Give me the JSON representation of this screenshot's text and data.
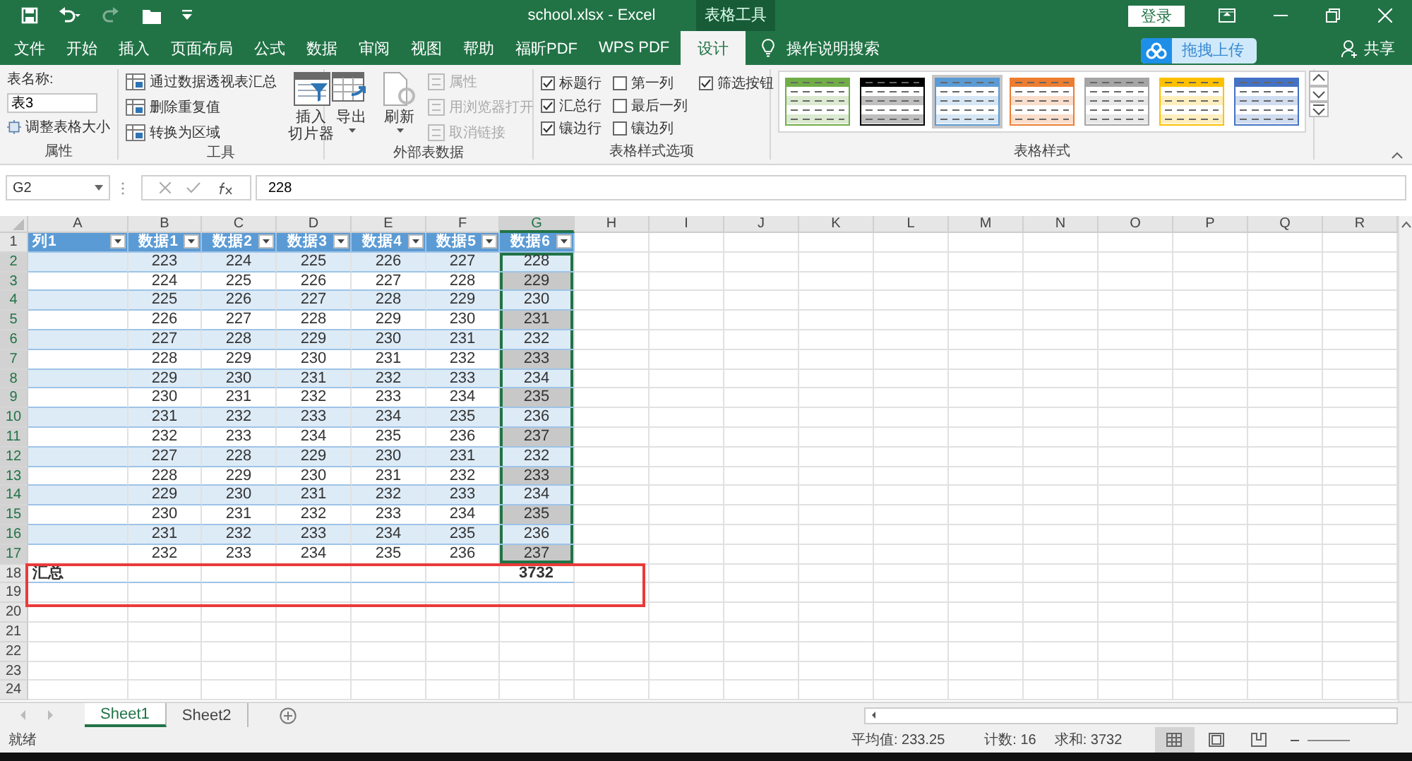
{
  "title_bar": {
    "title": "school.xlsx  -  Excel",
    "context_label": "表格工具",
    "login": "登录"
  },
  "ribbon_tabs": [
    {
      "label": "文件",
      "selected": false
    },
    {
      "label": "开始",
      "selected": false
    },
    {
      "label": "插入",
      "selected": false
    },
    {
      "label": "页面布局",
      "selected": false
    },
    {
      "label": "公式",
      "selected": false
    },
    {
      "label": "数据",
      "selected": false
    },
    {
      "label": "审阅",
      "selected": false
    },
    {
      "label": "视图",
      "selected": false
    },
    {
      "label": "帮助",
      "selected": false
    },
    {
      "label": "福昕PDF",
      "selected": false
    },
    {
      "label": "WPS PDF",
      "selected": false
    },
    {
      "label": "设计",
      "selected": true
    }
  ],
  "tell_me": "操作说明搜索",
  "upload": "拖拽上传",
  "share": "共享",
  "ribbon": {
    "properties": {
      "title": "属性",
      "name_label": "表名称:",
      "table_name": "表3",
      "resize": "调整表格大小"
    },
    "tools": {
      "title": "工具",
      "items": [
        "通过数据透视表汇总",
        "删除重复值",
        "转换为区域"
      ],
      "slicer": [
        "插入",
        "切片器"
      ]
    },
    "external": {
      "title": "外部表数据",
      "export": "导出",
      "refresh": "刷新",
      "items": [
        {
          "label": "属性",
          "disabled": true
        },
        {
          "label": "用浏览器打开",
          "disabled": true
        },
        {
          "label": "取消链接",
          "disabled": true
        }
      ]
    },
    "style_options": {
      "title": "表格样式选项",
      "options": [
        {
          "label": "标题行",
          "checked": true
        },
        {
          "label": "汇总行",
          "checked": true
        },
        {
          "label": "镶边行",
          "checked": true
        },
        {
          "label": "第一列",
          "checked": false
        },
        {
          "label": "最后一列",
          "checked": false
        },
        {
          "label": "镶边列",
          "checked": false
        },
        {
          "label": "筛选按钮",
          "checked": true
        }
      ]
    },
    "styles": {
      "title": "表格样式",
      "swatches": [
        {
          "color": "#70ad47",
          "selected": false
        },
        {
          "color": "#000000",
          "selected": false
        },
        {
          "color": "#5b9bd5",
          "selected": true
        },
        {
          "color": "#ed7d31",
          "selected": false
        },
        {
          "color": "#a5a5a5",
          "selected": false
        },
        {
          "color": "#ffc000",
          "selected": false
        },
        {
          "color": "#4472c4",
          "selected": false
        }
      ]
    }
  },
  "formula_bar": {
    "name_box": "G2",
    "formula": "228"
  },
  "sheet": {
    "columns": [
      {
        "letter": "A",
        "selected": false
      },
      {
        "letter": "B",
        "selected": false
      },
      {
        "letter": "C",
        "selected": false
      },
      {
        "letter": "D",
        "selected": false
      },
      {
        "letter": "E",
        "selected": false
      },
      {
        "letter": "F",
        "selected": false
      },
      {
        "letter": "G",
        "selected": true
      },
      {
        "letter": "H",
        "selected": false
      },
      {
        "letter": "I",
        "selected": false
      },
      {
        "letter": "J",
        "selected": false
      },
      {
        "letter": "K",
        "selected": false
      },
      {
        "letter": "L",
        "selected": false
      },
      {
        "letter": "M",
        "selected": false
      },
      {
        "letter": "N",
        "selected": false
      },
      {
        "letter": "O",
        "selected": false
      },
      {
        "letter": "P",
        "selected": false
      },
      {
        "letter": "Q",
        "selected": false
      },
      {
        "letter": "R",
        "selected": false
      }
    ],
    "row_numbers": [
      {
        "label": "1",
        "selected": false
      },
      {
        "label": "2",
        "selected": true
      },
      {
        "label": "3",
        "selected": true
      },
      {
        "label": "4",
        "selected": true
      },
      {
        "label": "5",
        "selected": true
      },
      {
        "label": "6",
        "selected": true
      },
      {
        "label": "7",
        "selected": true
      },
      {
        "label": "8",
        "selected": true
      },
      {
        "label": "9",
        "selected": true
      },
      {
        "label": "10",
        "selected": true
      },
      {
        "label": "11",
        "selected": true
      },
      {
        "label": "12",
        "selected": true
      },
      {
        "label": "13",
        "selected": true
      },
      {
        "label": "14",
        "selected": true
      },
      {
        "label": "15",
        "selected": true
      },
      {
        "label": "16",
        "selected": true
      },
      {
        "label": "17",
        "selected": true
      },
      {
        "label": "18",
        "selected": false
      },
      {
        "label": "19",
        "selected": false
      },
      {
        "label": "20",
        "selected": false
      },
      {
        "label": "21",
        "selected": false
      },
      {
        "label": "22",
        "selected": false
      },
      {
        "label": "23",
        "selected": false
      },
      {
        "label": "24",
        "selected": false
      }
    ],
    "table": {
      "header": [
        "列1",
        "数据1",
        "数据2",
        "数据3",
        "数据4",
        "数据5",
        "数据6"
      ],
      "rows": [
        {
          "values": [
            "223",
            "224",
            "225",
            "226",
            "227",
            "228"
          ]
        },
        {
          "values": [
            "224",
            "225",
            "226",
            "227",
            "228",
            "229"
          ]
        },
        {
          "values": [
            "225",
            "226",
            "227",
            "228",
            "229",
            "230"
          ]
        },
        {
          "values": [
            "226",
            "227",
            "228",
            "229",
            "230",
            "231"
          ]
        },
        {
          "values": [
            "227",
            "228",
            "229",
            "230",
            "231",
            "232"
          ]
        },
        {
          "values": [
            "228",
            "229",
            "230",
            "231",
            "232",
            "233"
          ]
        },
        {
          "values": [
            "229",
            "230",
            "231",
            "232",
            "233",
            "234"
          ]
        },
        {
          "values": [
            "230",
            "231",
            "232",
            "233",
            "234",
            "235"
          ]
        },
        {
          "values": [
            "231",
            "232",
            "233",
            "234",
            "235",
            "236"
          ]
        },
        {
          "values": [
            "232",
            "233",
            "234",
            "235",
            "236",
            "237"
          ]
        },
        {
          "values": [
            "227",
            "228",
            "229",
            "230",
            "231",
            "232"
          ]
        },
        {
          "values": [
            "228",
            "229",
            "230",
            "231",
            "232",
            "233"
          ]
        },
        {
          "values": [
            "229",
            "230",
            "231",
            "232",
            "233",
            "234"
          ]
        },
        {
          "values": [
            "230",
            "231",
            "232",
            "233",
            "234",
            "235"
          ]
        },
        {
          "values": [
            "231",
            "232",
            "233",
            "234",
            "235",
            "236"
          ]
        },
        {
          "values": [
            "232",
            "233",
            "234",
            "235",
            "236",
            "237"
          ]
        }
      ],
      "total": {
        "label": "汇总",
        "value": "3732"
      }
    }
  },
  "sheet_tabs": [
    {
      "label": "Sheet1",
      "selected": true
    },
    {
      "label": "Sheet2",
      "selected": false
    }
  ],
  "status_bar": {
    "mode": "就绪",
    "average": "平均值: 233.25",
    "count": "计数: 16",
    "sum": "求和: 3732",
    "views": [
      {
        "kind": "normal",
        "selected": true
      },
      {
        "kind": "page_layout",
        "selected": false
      },
      {
        "kind": "page_break",
        "selected": false
      }
    ]
  }
}
